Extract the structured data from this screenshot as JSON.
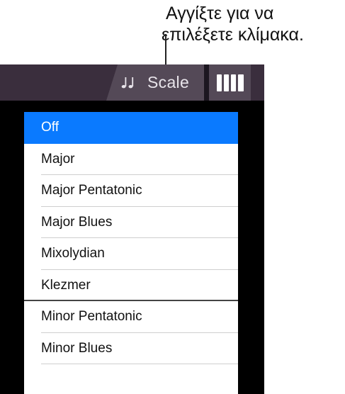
{
  "callout": {
    "line1": "Αγγίξτε για να",
    "line2": "επιλέξετε κλίμακα."
  },
  "toolbar": {
    "scale_label": "Scale",
    "scale_icon": "musical-notes-icon",
    "keyboard_icon": "keyboard-keys-icon",
    "colors": {
      "bar": "#3a2e3d",
      "button": "#544957"
    }
  },
  "scale_menu": {
    "selected": "Off",
    "accent": "#0a7aff",
    "items": [
      {
        "label": "Off"
      },
      {
        "label": "Major"
      },
      {
        "label": "Major Pentatonic"
      },
      {
        "label": "Major Blues"
      },
      {
        "label": "Mixolydian"
      },
      {
        "label": "Klezmer"
      },
      {
        "label": "Minor Pentatonic"
      },
      {
        "label": "Minor Blues"
      },
      {
        "label": ""
      }
    ]
  }
}
